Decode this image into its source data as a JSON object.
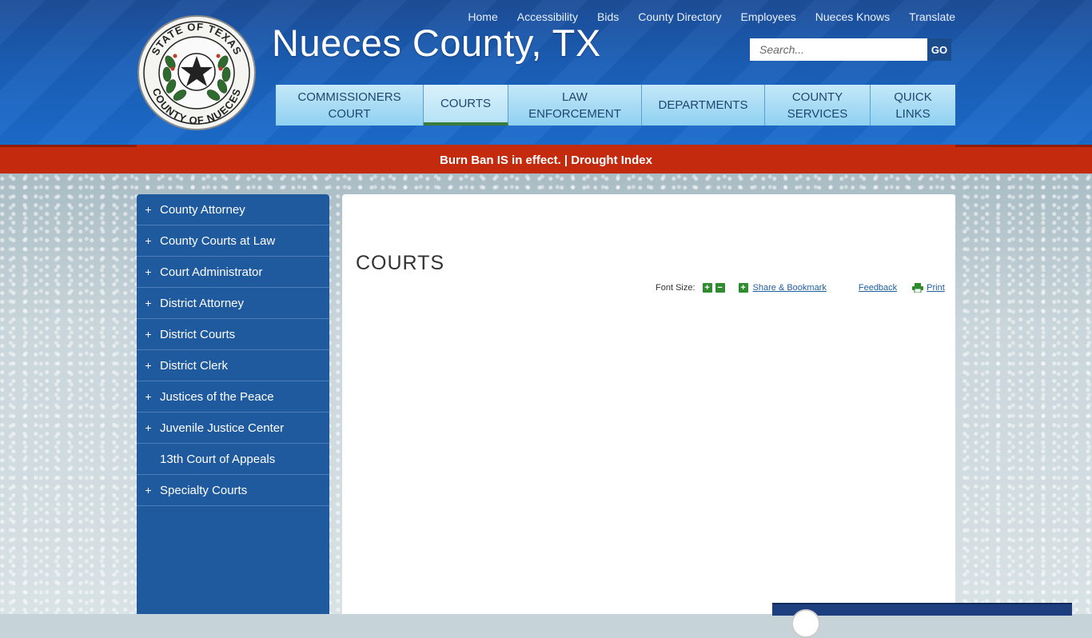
{
  "site": {
    "title": "Nueces County, TX",
    "seal_text_top": "STATE OF TEXAS",
    "seal_text_bottom": "COUNTY OF NUECES"
  },
  "top_links": [
    "Home",
    "Accessibility",
    "Bids",
    "County Directory",
    "Employees",
    "Nueces Knows",
    "Translate"
  ],
  "search": {
    "placeholder": "Search...",
    "button": "GO"
  },
  "main_nav": [
    {
      "label_line1": "COMMISSIONERS",
      "label_line2": "COURT"
    },
    {
      "label_line1": "COURTS",
      "label_line2": ""
    },
    {
      "label_line1": "LAW",
      "label_line2": "ENFORCEMENT"
    },
    {
      "label_line1": "DEPARTMENTS",
      "label_line2": ""
    },
    {
      "label_line1": "COUNTY",
      "label_line2": "SERVICES"
    },
    {
      "label_line1": "QUICK",
      "label_line2": "LINKS"
    }
  ],
  "alert": {
    "text": "Burn Ban IS in effect. | Drought Index"
  },
  "sidebar": {
    "items": [
      {
        "label": "County Attorney",
        "prefix": "+"
      },
      {
        "label": "County Courts at Law",
        "prefix": "+"
      },
      {
        "label": "Court Administrator",
        "prefix": "+"
      },
      {
        "label": "District Attorney",
        "prefix": "+"
      },
      {
        "label": "District Courts",
        "prefix": "+"
      },
      {
        "label": "District Clerk",
        "prefix": "+"
      },
      {
        "label": "Justices of the Peace",
        "prefix": "+"
      },
      {
        "label": "Juvenile Justice Center",
        "prefix": "+"
      },
      {
        "label": "13th Court of Appeals",
        "prefix": ""
      },
      {
        "label": "Specialty Courts",
        "prefix": "+"
      }
    ]
  },
  "content": {
    "title": "COURTS",
    "font_size_label": "Font Size:",
    "increase": "+",
    "decrease": "−",
    "share_icon": "+",
    "share_label": "Share & Bookmark",
    "feedback_label": "Feedback",
    "print_label": "Print"
  },
  "colors": {
    "header_blue": "#1a5fb8",
    "alert_red": "#c42a0d",
    "sidebar_blue": "#1f5a9e",
    "nav_light": "#8fd1f1",
    "accent_green": "#2e8b2e"
  }
}
